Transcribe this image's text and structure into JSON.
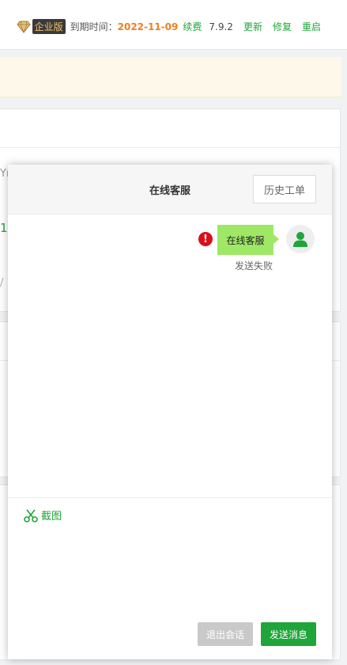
{
  "header": {
    "edition_badge": "企业版",
    "expire_label": "到期时间：",
    "expire_date": "2022-11-09",
    "renew_label": "续费",
    "version": "7.9.2",
    "links": [
      "更新",
      "修复",
      "重启"
    ]
  },
  "background": {
    "fragments": [
      "Yr",
      "1",
      "/"
    ]
  },
  "chat": {
    "title": "在线客服",
    "history_button": "历史工单",
    "message": {
      "text": "在线客服",
      "status": "发送失败",
      "error_icon_text": "!"
    },
    "screenshot_label": "截图",
    "exit_button": "退出会话",
    "send_button": "发送消息"
  },
  "colors": {
    "accent_green": "#20a53a",
    "date_orange": "#f07e1d",
    "bubble_green": "#9fe865",
    "error_red": "#d9101c"
  },
  "icons": [
    "diamond-icon",
    "error-icon",
    "user-avatar-icon",
    "scissors-icon"
  ]
}
